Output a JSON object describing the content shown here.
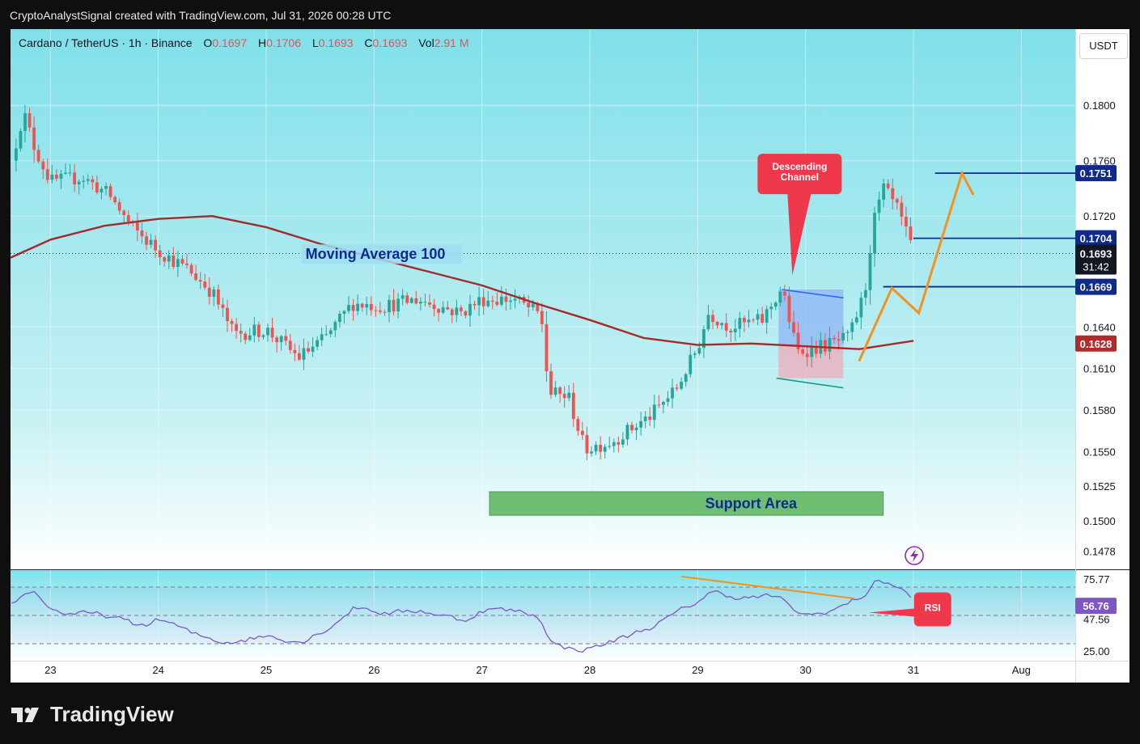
{
  "header": {
    "credit": "CryptoAnalystSignal created with TradingView.com, Jul 31, 2026 00:28 UTC"
  },
  "legend": {
    "symbol": "Cardano / TetherUS · 1h · Binance",
    "open_label": "O",
    "open": "0.1697",
    "high_label": "H",
    "high": "0.1706",
    "low_label": "L",
    "low": "0.1693",
    "close_label": "C",
    "close": "0.1693",
    "vol_label": "Vol",
    "vol": "2.91 M"
  },
  "unit_button": "USDT",
  "logo": {
    "text": "TradingView"
  },
  "colors": {
    "up": "#26a69a",
    "down": "#ef5350",
    "ma": "#a52a2a",
    "level": "#0d2a8c",
    "projection": "#f5921e",
    "rsi": "#7e57c2",
    "support": "#6fbf73",
    "callout": "#f0384c",
    "background_top": "#80e0ea",
    "background_bottom": "#ffffff"
  },
  "chart_data": [
    {
      "type": "candlestick",
      "title": "Cardano / TetherUS · 1h · Binance",
      "ylim": [
        0.1465,
        0.1855
      ],
      "y_ticks": [
        "0.1800",
        "0.1760",
        "0.1720",
        "0.1640",
        "0.1610",
        "0.1580",
        "0.1550",
        "0.1525",
        "0.1500",
        "0.1478"
      ],
      "x_ticks": [
        "23",
        "24",
        "25",
        "26",
        "27",
        "28",
        "29",
        "30",
        "31",
        "Aug"
      ],
      "x_tick_positions_days": [
        23,
        24,
        25,
        26,
        27,
        28,
        29,
        30,
        31,
        32
      ],
      "x_range_days": [
        22.63,
        32.5
      ],
      "price_anchors": [
        [
          22.64,
          0.176
        ],
        [
          22.75,
          0.1795
        ],
        [
          22.85,
          0.177
        ],
        [
          23.0,
          0.1745
        ],
        [
          23.3,
          0.1748
        ],
        [
          23.55,
          0.1735
        ],
        [
          23.75,
          0.1712
        ],
        [
          24.0,
          0.1695
        ],
        [
          24.3,
          0.168
        ],
        [
          24.5,
          0.1665
        ],
        [
          24.7,
          0.1635
        ],
        [
          25.0,
          0.1638
        ],
        [
          25.3,
          0.1618
        ],
        [
          25.55,
          0.1632
        ],
        [
          25.8,
          0.1657
        ],
        [
          26.1,
          0.1655
        ],
        [
          26.4,
          0.166
        ],
        [
          26.8,
          0.165
        ],
        [
          27.0,
          0.166
        ],
        [
          27.3,
          0.166
        ],
        [
          27.55,
          0.1648
        ],
        [
          27.62,
          0.1592
        ],
        [
          27.8,
          0.159
        ],
        [
          27.95,
          0.1552
        ],
        [
          28.2,
          0.1557
        ],
        [
          28.55,
          0.1575
        ],
        [
          28.8,
          0.1595
        ],
        [
          29.0,
          0.1625
        ],
        [
          29.1,
          0.165
        ],
        [
          29.3,
          0.164
        ],
        [
          29.6,
          0.1645
        ],
        [
          29.78,
          0.1668
        ],
        [
          29.92,
          0.1622
        ],
        [
          30.2,
          0.1627
        ],
        [
          30.4,
          0.1632
        ],
        [
          30.55,
          0.1665
        ],
        [
          30.62,
          0.1712
        ],
        [
          30.72,
          0.174
        ],
        [
          30.85,
          0.1725
        ],
        [
          31.0,
          0.1693
        ]
      ],
      "last_price": "0.1693",
      "countdown": "31:42",
      "price_line_labels": [
        {
          "value": 0.1751,
          "label": "0.1751",
          "role": "level"
        },
        {
          "value": 0.1704,
          "label": "0.1704",
          "role": "level"
        },
        {
          "value": 0.1669,
          "label": "0.1669",
          "role": "level"
        },
        {
          "value": 0.1628,
          "label": "0.1628",
          "role": "ma"
        }
      ],
      "horizontal_levels": [
        {
          "value": 0.1751,
          "from_day": 31.2,
          "to_day": 32.5
        },
        {
          "value": 0.1704,
          "from_day": 31.0,
          "to_day": 32.5
        },
        {
          "value": 0.1669,
          "from_day": 30.72,
          "to_day": 32.5
        }
      ],
      "moving_average_100": [
        [
          22.63,
          0.169
        ],
        [
          23.0,
          0.1703
        ],
        [
          23.5,
          0.1713
        ],
        [
          24.0,
          0.1718
        ],
        [
          24.5,
          0.172
        ],
        [
          25.0,
          0.1712
        ],
        [
          25.5,
          0.17
        ],
        [
          26.0,
          0.169
        ],
        [
          26.5,
          0.168
        ],
        [
          27.0,
          0.167
        ],
        [
          27.5,
          0.1657
        ],
        [
          28.0,
          0.1645
        ],
        [
          28.5,
          0.1632
        ],
        [
          29.0,
          0.1627
        ],
        [
          29.5,
          0.1628
        ],
        [
          30.0,
          0.1626
        ],
        [
          30.5,
          0.1624
        ],
        [
          31.0,
          0.163
        ]
      ],
      "support_area": {
        "label": "Support Area",
        "y_range": [
          0.1504,
          0.1521
        ],
        "x_range_days": [
          27.07,
          30.72
        ]
      },
      "descending_channel": {
        "callout": [
          "Descending",
          "Channel"
        ],
        "upper": [
          [
            29.78,
            0.1667
          ],
          [
            30.35,
            0.1661
          ]
        ],
        "lower": [
          [
            29.73,
            0.1603
          ],
          [
            30.35,
            0.1596
          ]
        ],
        "upper_box_y": [
          0.1627,
          0.1667
        ],
        "lower_box_y": [
          0.1603,
          0.1627
        ],
        "x_range_days": [
          29.75,
          30.35
        ]
      },
      "projection_path": [
        [
          30.5,
          0.1616
        ],
        [
          30.8,
          0.1668
        ],
        [
          31.05,
          0.165
        ],
        [
          31.45,
          0.1751
        ],
        [
          31.55,
          0.1736
        ]
      ],
      "annotations": [
        {
          "text": "Moving Average 100",
          "x_day": 25.35,
          "y": 0.1692
        }
      ]
    },
    {
      "type": "line",
      "title": "RSI",
      "ylim": [
        18,
        82
      ],
      "y_ticks": [
        "75.77",
        "47.56",
        "25.00"
      ],
      "last_value": "56.76",
      "guides": [
        70,
        50,
        30
      ],
      "rsi_anchors": [
        [
          22.63,
          58
        ],
        [
          22.8,
          70
        ],
        [
          23.0,
          52
        ],
        [
          23.5,
          50
        ],
        [
          23.8,
          42
        ],
        [
          24.0,
          48
        ],
        [
          24.3,
          36
        ],
        [
          24.6,
          31
        ],
        [
          25.0,
          36
        ],
        [
          25.3,
          31
        ],
        [
          25.6,
          44
        ],
        [
          25.8,
          57
        ],
        [
          26.1,
          51
        ],
        [
          26.4,
          54
        ],
        [
          26.8,
          46
        ],
        [
          27.0,
          55
        ],
        [
          27.4,
          52
        ],
        [
          27.55,
          46
        ],
        [
          27.62,
          27
        ],
        [
          27.95,
          26
        ],
        [
          28.3,
          35
        ],
        [
          28.6,
          44
        ],
        [
          28.9,
          57
        ],
        [
          29.1,
          67
        ],
        [
          29.4,
          62
        ],
        [
          29.72,
          64
        ],
        [
          29.82,
          55
        ],
        [
          30.0,
          49
        ],
        [
          30.3,
          56
        ],
        [
          30.55,
          66
        ],
        [
          30.62,
          76
        ],
        [
          30.8,
          72
        ],
        [
          31.0,
          59
        ]
      ],
      "divergence_line": [
        [
          28.85,
          77.5
        ],
        [
          30.45,
          62
        ]
      ],
      "callout": "RSI"
    }
  ]
}
